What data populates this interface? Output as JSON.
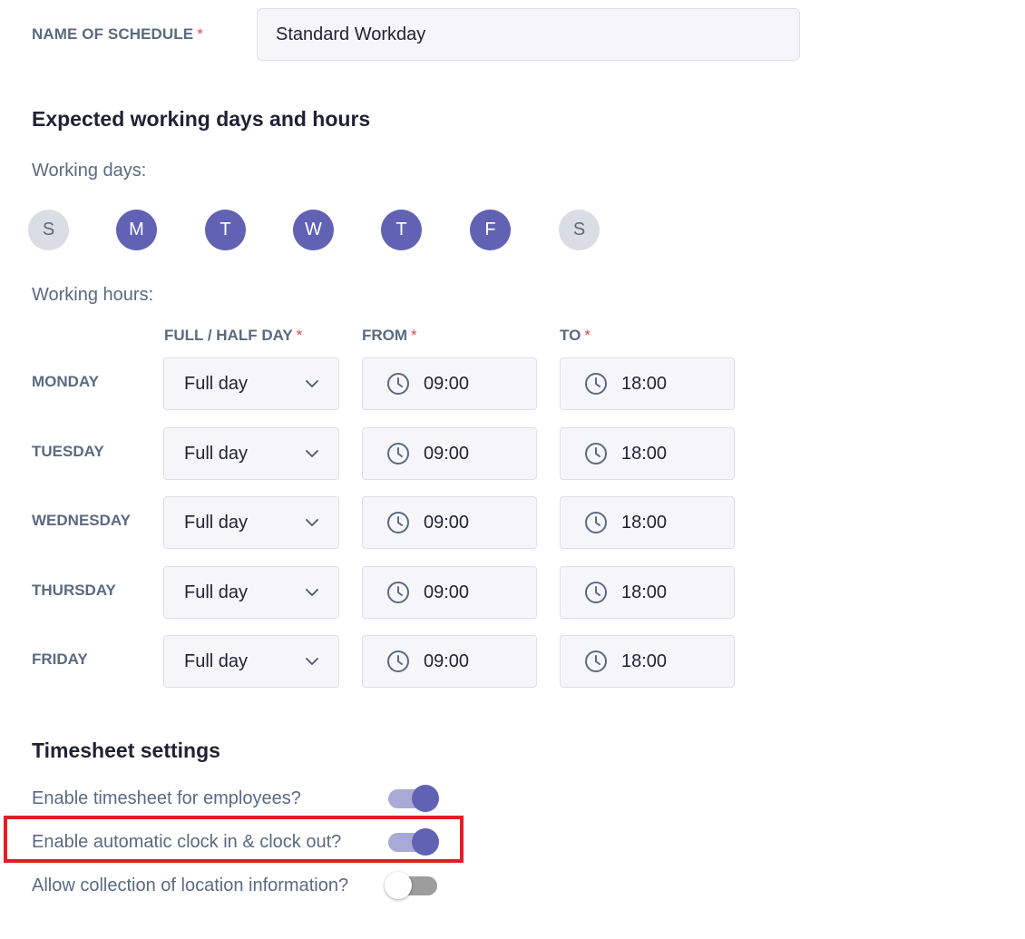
{
  "schedule": {
    "name_label": "NAME OF SCHEDULE",
    "required_mark": "*",
    "name_value": "Standard Workday"
  },
  "working": {
    "title": "Expected working days and hours",
    "days_label": "Working days:",
    "days": [
      {
        "letter": "S",
        "selected": false
      },
      {
        "letter": "M",
        "selected": true
      },
      {
        "letter": "T",
        "selected": true
      },
      {
        "letter": "W",
        "selected": true
      },
      {
        "letter": "T",
        "selected": true
      },
      {
        "letter": "F",
        "selected": true
      },
      {
        "letter": "S",
        "selected": false
      }
    ],
    "hours_label": "Working hours:",
    "columns": {
      "day_type": "FULL / HALF DAY",
      "from": "FROM",
      "to": "TO"
    },
    "rows": [
      {
        "day": "MONDAY",
        "type": "Full day",
        "from": "09:00",
        "to": "18:00"
      },
      {
        "day": "TUESDAY",
        "type": "Full day",
        "from": "09:00",
        "to": "18:00"
      },
      {
        "day": "WEDNESDAY",
        "type": "Full day",
        "from": "09:00",
        "to": "18:00"
      },
      {
        "day": "THURSDAY",
        "type": "Full day",
        "from": "09:00",
        "to": "18:00"
      },
      {
        "day": "FRIDAY",
        "type": "Full day",
        "from": "09:00",
        "to": "18:00"
      }
    ]
  },
  "timesheet": {
    "title": "Timesheet settings",
    "toggles": [
      {
        "label": "Enable timesheet for employees?",
        "on": true
      },
      {
        "label": "Enable automatic clock in & clock out?",
        "on": true
      },
      {
        "label": "Allow collection of location information?",
        "on": false
      }
    ]
  },
  "colors": {
    "accent": "#6262b4",
    "accent_light": "#a9a9d6",
    "day_off": "#dadde3",
    "required": "#e0464f",
    "highlight": "#e31d24",
    "label": "#5a6a80"
  },
  "icons": {
    "select": "chevron-down-icon",
    "time": "clock-icon"
  }
}
